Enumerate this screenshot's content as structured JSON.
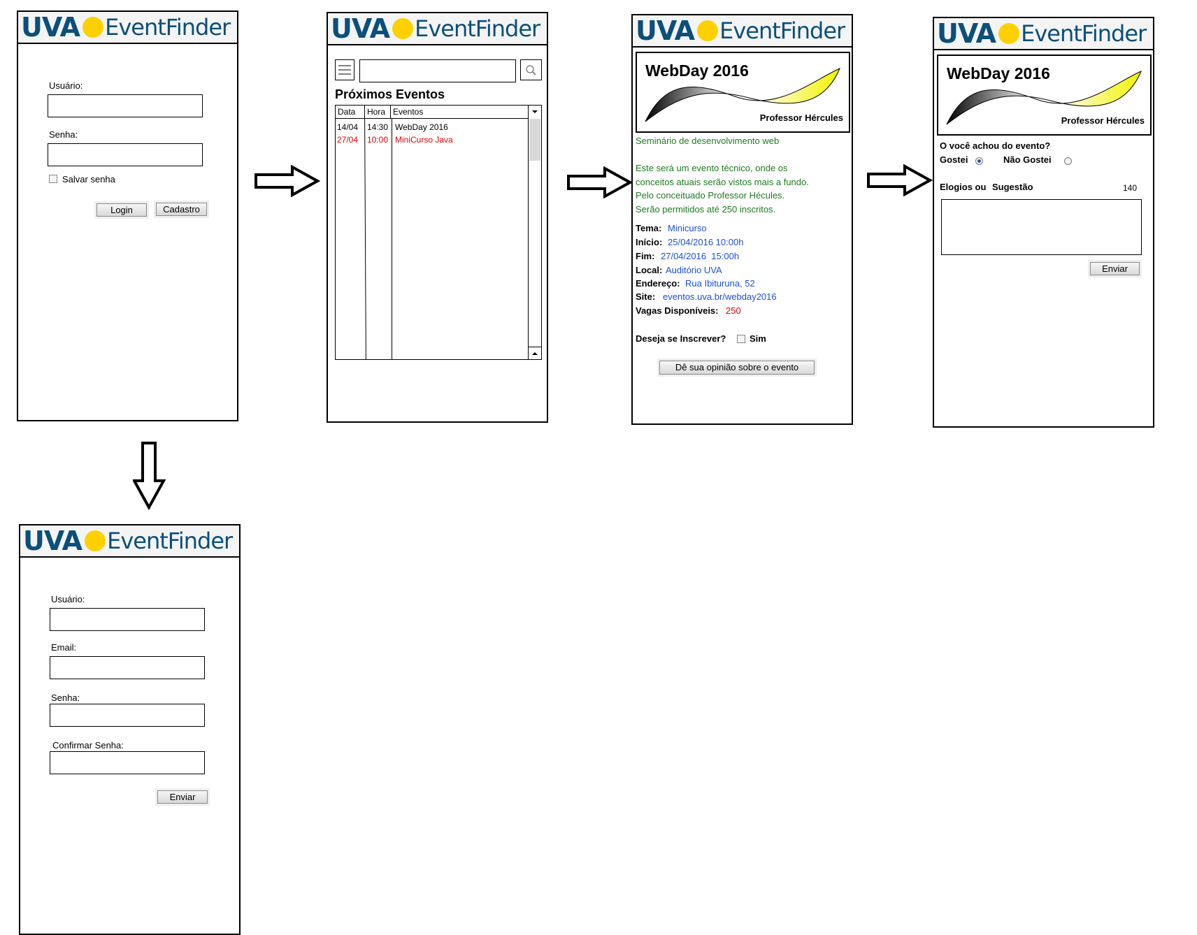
{
  "logo": {
    "uva": "UVA",
    "eventfinder": "EventFinder"
  },
  "login": {
    "user_label": "Usuário:",
    "password_label": "Senha:",
    "save_password": "Salvar senha",
    "login_button": "Login",
    "register_button": "Cadastro"
  },
  "events": {
    "title": "Próximos Eventos",
    "columns": [
      "Data",
      "Hora",
      "Eventos"
    ],
    "rows": [
      {
        "date": "14/04",
        "time": "14:30",
        "event": "WebDay 2016"
      },
      {
        "date": "27/04",
        "time": "10:00",
        "event": "MiniCurso Java"
      }
    ]
  },
  "detail": {
    "banner_title": "WebDay 2016",
    "banner_subtitle": "Professor Hércules",
    "summary": "Seminário de desenvolvimento web",
    "description": [
      "Este será um evento técnico, onde os",
      "conceitos atuais serão vistos mais a fundo.",
      "Pelo conceituado Professor Hécules.",
      "Serão permitidos até 250 inscritos."
    ],
    "fields": {
      "tema_label": "Tema:",
      "tema_value": "Minicurso",
      "inicio_label": "Início:",
      "inicio_value": "25/04/2016 10:00h",
      "fim_label": "Fim:",
      "fim_value": "27/04/2016  15:00h",
      "local_label": "Local:",
      "local_value": "Auditório UVA",
      "endereco_label": "Endereço:",
      "endereco_value": "Rua Ibituruna, 52",
      "site_label": "Site:",
      "site_value": "eventos.uva.br/webday2016",
      "vagas_label": "Vagas Disponíveis:",
      "vagas_value": "250"
    },
    "subscribe_question": "Deseja se Inscrever?",
    "subscribe_option": "Sim",
    "opinion_button": "Dê sua opinião sobre o evento"
  },
  "feedback": {
    "banner_title": "WebDay 2016",
    "banner_subtitle": "Professor Hércules",
    "question": "O você achou do evento?",
    "liked": "Gostei",
    "disliked": "Não Gostei",
    "comments_label_a": "Elogios ou",
    "comments_label_b": "Sugestão",
    "char_count": "140",
    "send_button": "Enviar"
  },
  "register": {
    "user_label": "Usuário:",
    "email_label": "Email:",
    "password_label": "Senha:",
    "confirm_label": "Confirmar Senha:",
    "send_button": "Enviar"
  },
  "colors": {
    "logo_blue": "#0b4f7a",
    "logo_yellow": "#ffd000",
    "text_green": "#1f7a1f",
    "link_blue": "#1a4fd6",
    "highlight_red": "#e00000"
  }
}
